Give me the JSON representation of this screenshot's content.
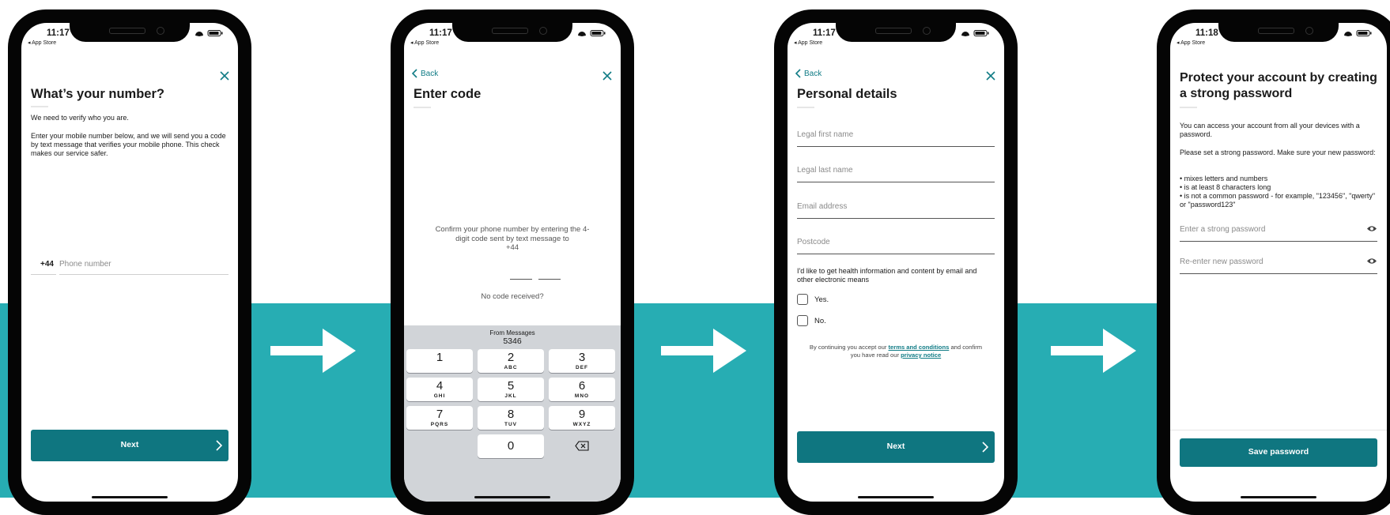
{
  "status_bar": {
    "screens": [
      {
        "time": "11:17",
        "back_app": "◂ App Store"
      },
      {
        "time": "11:17",
        "back_app": "◂ App Store"
      },
      {
        "time": "11:17",
        "back_app": "◂ App Store"
      },
      {
        "time": "11:18",
        "back_app": "◂ App Store"
      }
    ]
  },
  "screen1": {
    "title": "What’s your number?",
    "intro": "We need to verify who you are.",
    "body": "Enter your mobile number below, and we will send you a code by text message that verifies your mobile phone. This check makes our service safer.",
    "country_code": "+44",
    "phone_placeholder": "Phone number",
    "next_label": "Next"
  },
  "screen2": {
    "back_label": "Back",
    "title": "Enter code",
    "instructions": "Confirm your phone number by entering the 4-digit code sent by text message to",
    "phone_prefix": "+44",
    "no_code": "No code received?",
    "suggestion_source": "From Messages",
    "suggestion_code": "5346",
    "keys": [
      {
        "digit": "1",
        "letters": ""
      },
      {
        "digit": "2",
        "letters": "ABC"
      },
      {
        "digit": "3",
        "letters": "DEF"
      },
      {
        "digit": "4",
        "letters": "GHI"
      },
      {
        "digit": "5",
        "letters": "JKL"
      },
      {
        "digit": "6",
        "letters": "MNO"
      },
      {
        "digit": "7",
        "letters": "PQRS"
      },
      {
        "digit": "8",
        "letters": "TUV"
      },
      {
        "digit": "9",
        "letters": "WXYZ"
      },
      {
        "digit": "0",
        "letters": ""
      }
    ]
  },
  "screen3": {
    "back_label": "Back",
    "title": "Personal details",
    "fields": [
      "Legal first name",
      "Legal last name",
      "Email address",
      "Postcode"
    ],
    "consent_question": "I'd like to get health information and content by email and other electronic means",
    "option_yes": "Yes.",
    "option_no": "No.",
    "legal_prefix": "By continuing you accept our",
    "terms_link": "terms and conditions",
    "legal_middle": "and confirm you have read our",
    "privacy_link": "privacy notice",
    "next_label": "Next"
  },
  "screen4": {
    "title": "Protect your account by creating a strong password",
    "intro": "You can access your account from all your devices with a password.",
    "instruction": "Please set a strong password. Make sure your new password:",
    "rules": [
      "• mixes letters and numbers",
      "• is at least 8 characters long",
      "• is not a common password - for example, \"123456\", \"qwerty\" or \"password123\""
    ],
    "password_placeholder": "Enter a strong password",
    "repeat_placeholder": "Re-enter new password",
    "save_label": "Save password"
  },
  "colors": {
    "brand_teal": "#0f7680",
    "background_band": "#27adb3",
    "link": "#117c86"
  }
}
